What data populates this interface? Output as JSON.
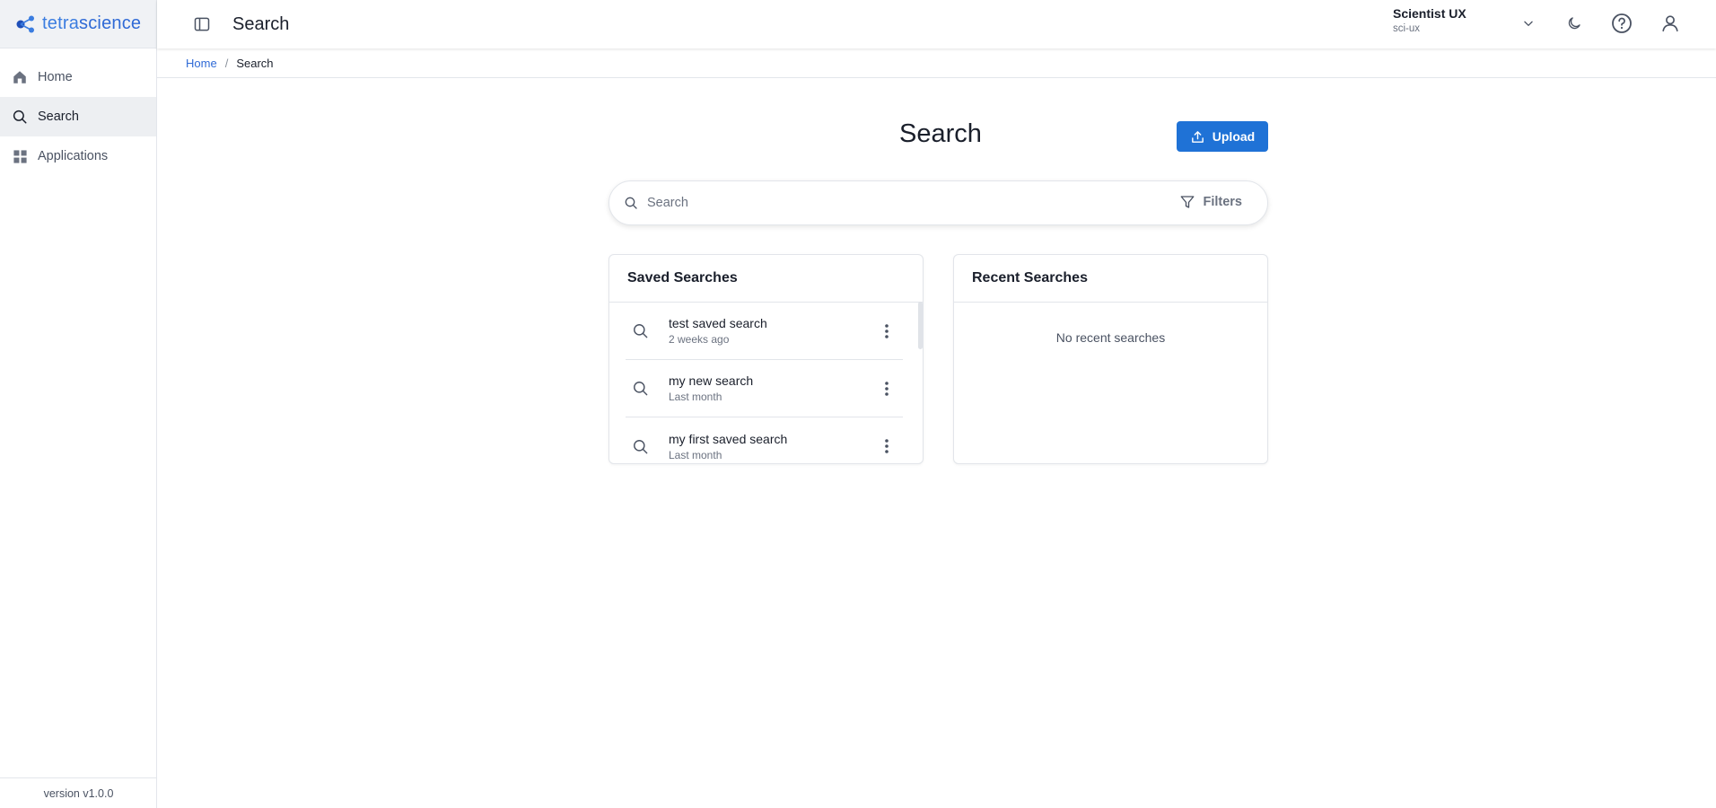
{
  "brand": {
    "logo_text_a": "tetra",
    "logo_text_b": "science"
  },
  "sidebar": {
    "items": [
      {
        "label": "Home",
        "icon": "home-icon"
      },
      {
        "label": "Search",
        "icon": "search-icon",
        "active": true
      },
      {
        "label": "Applications",
        "icon": "grid-icon"
      }
    ],
    "version": "version v1.0.0"
  },
  "topbar": {
    "title": "Search",
    "org_name": "Scientist UX",
    "org_sub": "sci-ux"
  },
  "breadcrumb": {
    "home": "Home",
    "separator": "/",
    "current": "Search"
  },
  "main": {
    "title": "Search",
    "upload_label": "Upload",
    "search_placeholder": "Search",
    "filters_label": "Filters"
  },
  "saved_searches": {
    "title": "Saved Searches",
    "items": [
      {
        "title": "test saved search",
        "time": "2 weeks ago"
      },
      {
        "title": "my new search",
        "time": "Last month"
      },
      {
        "title": "my first saved search",
        "time": "Last month"
      }
    ]
  },
  "recent_searches": {
    "title": "Recent Searches",
    "empty": "No recent searches"
  },
  "colors": {
    "accent": "#1f72d6",
    "brand": "#3b7de0"
  }
}
